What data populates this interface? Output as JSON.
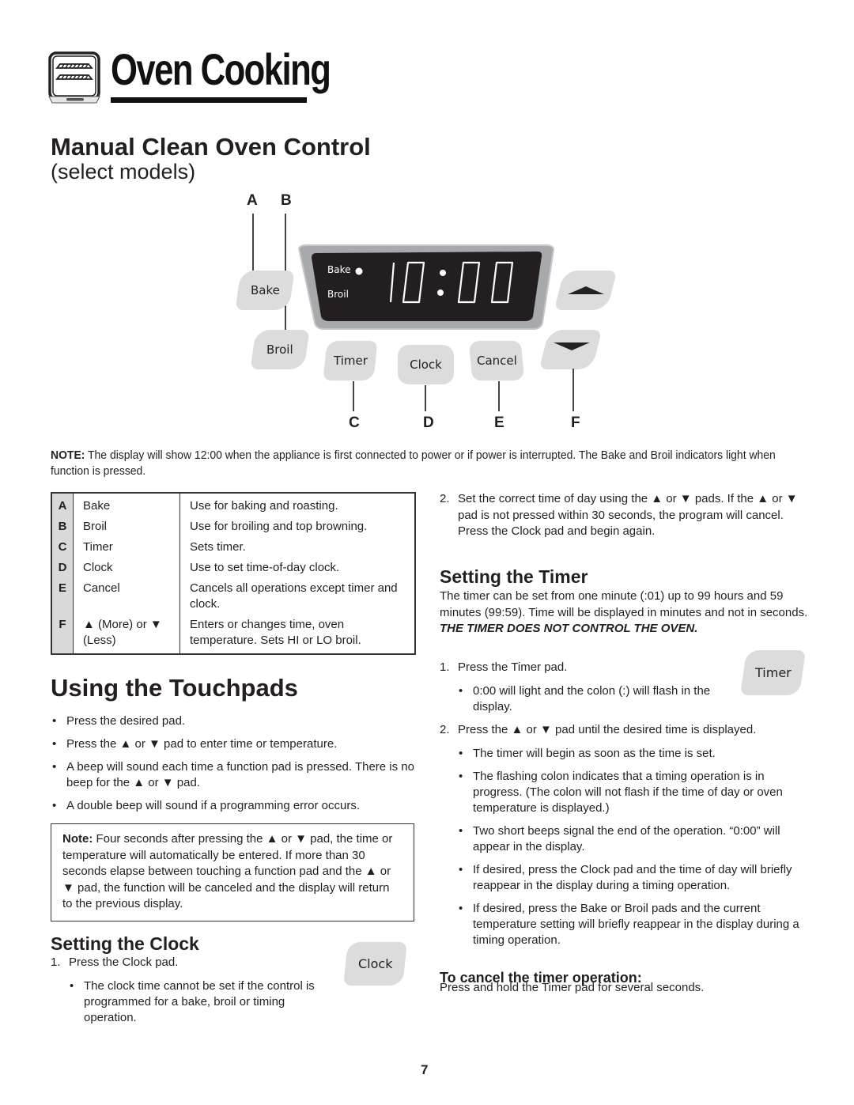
{
  "header": {
    "section_title": "Oven Cooking",
    "icon": "oven-icon"
  },
  "title": "Manual Clean Oven Control",
  "subtitle": "(select models)",
  "diagram": {
    "letters_top": [
      "A",
      "B"
    ],
    "letters_bottom": [
      "C",
      "D",
      "E",
      "F"
    ],
    "pads": {
      "bake": "Bake",
      "broil": "Broil",
      "timer": "Timer",
      "clock": "Clock",
      "cancel": "Cancel",
      "up": "up-arrow-icon",
      "down": "down-arrow-icon"
    },
    "display": {
      "indicator_bake": "Bake",
      "indicator_broil": "Broil",
      "time": "10:00",
      "bg_color": "#231f20",
      "frame_color": "#a7a9ac"
    }
  },
  "note_top": {
    "label": "NOTE:",
    "text": " The display will show 12:00 when the appliance is first connected to power or if power is interrupted. The Bake and Broil indicators light when function is pressed."
  },
  "legend": [
    {
      "key": "A",
      "name": "Bake",
      "desc": "Use for baking and roasting."
    },
    {
      "key": "B",
      "name": "Broil",
      "desc": "Use for broiling and top browning."
    },
    {
      "key": "C",
      "name": "Timer",
      "desc": "Sets timer."
    },
    {
      "key": "D",
      "name": "Clock",
      "desc": "Use to set time-of-day clock."
    },
    {
      "key": "E",
      "name": "Cancel",
      "desc": "Cancels all operations except timer and clock."
    },
    {
      "key": "F",
      "name": "▲ (More) or ▼ (Less)",
      "desc": "Enters or changes time, oven temperature.  Sets HI or LO broil."
    }
  ],
  "touchpads": {
    "title": "Using the Touchpads",
    "bullets": [
      "Press the desired pad.",
      "Press the ▲ or ▼ pad to enter time or temperature.",
      "A beep will sound each time a function pad is pressed. There is no beep for the ▲ or ▼ pad.",
      "A double beep will sound if a programming error occurs."
    ],
    "note_label": "Note:",
    "note_text": "  Four seconds after pressing the ▲ or ▼ pad, the time or temperature will automatically be entered.  If more than 30 seconds elapse between touching a function pad and the ▲ or ▼ pad, the function will be canceled and the display will return to the previous display."
  },
  "clock": {
    "title": "Setting the Clock",
    "step1_num": "1.",
    "step1": "Press the Clock pad.",
    "step1_bullets": [
      "The clock time cannot be set if the control is programmed for a bake, broil or timing operation."
    ],
    "pad_label": "Clock",
    "step2_num": "2.",
    "step2": "Set the correct time of day using the ▲ or ▼ pads. If the ▲ or ▼ pad is not pressed within 30 seconds, the program will cancel. Press the Clock pad and begin again."
  },
  "timer": {
    "title": "Setting the Timer",
    "intro": "The timer can be set from one minute (:01) up to 99 hours and 59 minutes (99:59). Time will be displayed in minutes and not in seconds. ",
    "warning": "THE TIMER DOES NOT CONTROL THE OVEN.",
    "pad_label": "Timer",
    "step1_num": "1.",
    "step1": "Press the Timer pad.",
    "step1_bullets": [
      "0:00 will light and the colon (:) will flash in the display."
    ],
    "step2_num": "2.",
    "step2": "Press the ▲ or ▼ pad until the desired time is displayed.",
    "step2_bullets": [
      "The timer will begin as soon as the time is set.",
      "The flashing colon indicates that a timing operation is in progress. (The colon will not flash if the time of day or oven temperature is displayed.)",
      "Two short beeps signal the end of the operation. “0:00” will appear in the display.",
      "If desired, press the Clock pad and the time of day will briefly reappear in the display during a timing operation.",
      "If desired, press the Bake or Broil pads and the current temperature setting will briefly reappear in the display during a timing operation."
    ],
    "cancel_title": "To cancel the timer operation:",
    "cancel_text": "Press and hold the Timer pad for several seconds."
  },
  "page_number": "7"
}
